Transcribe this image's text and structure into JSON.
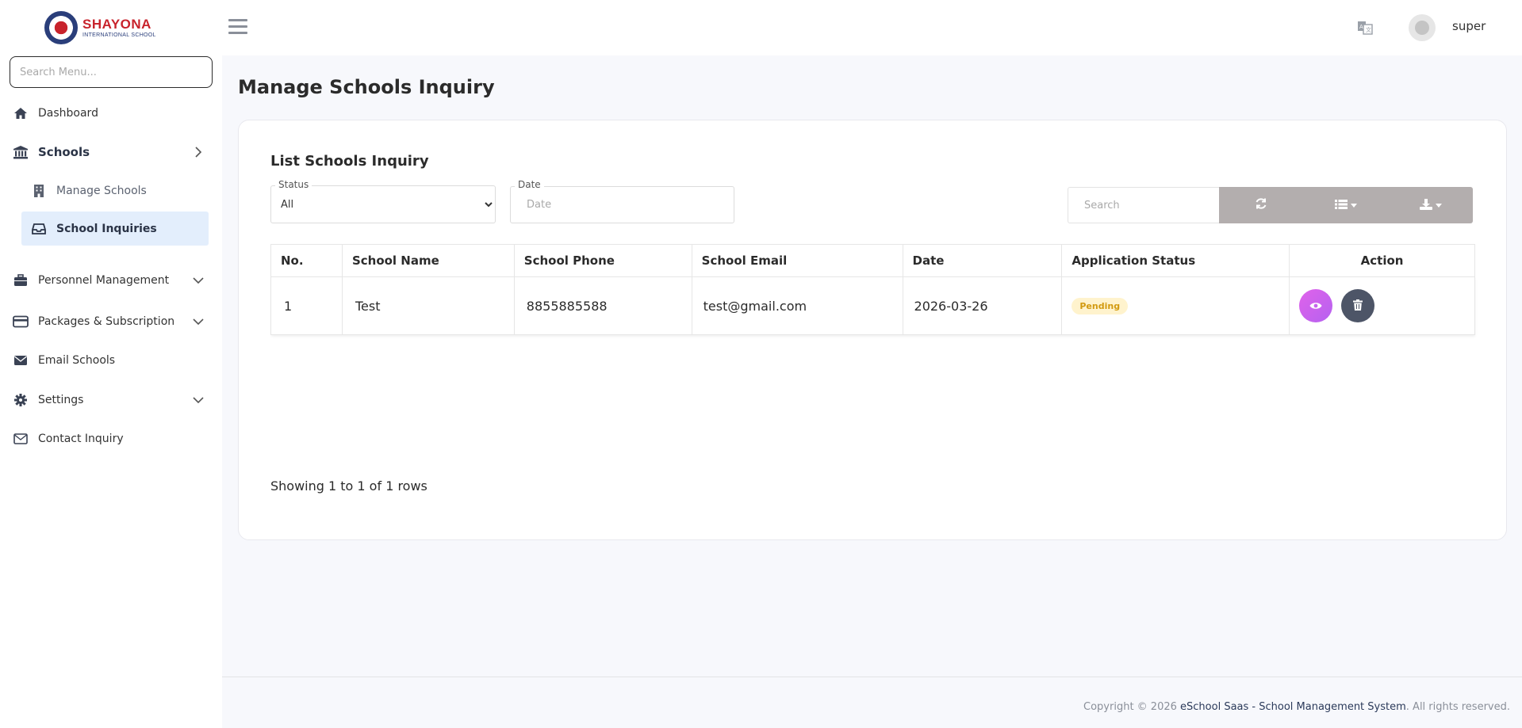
{
  "brand": {
    "name": "SHAYONA",
    "subtitle": "INTERNATIONAL SCHOOL"
  },
  "sidebar": {
    "search_placeholder": "Search Menu...",
    "items": [
      {
        "label": "Dashboard"
      },
      {
        "label": "Schools"
      },
      {
        "label": "Manage Schools"
      },
      {
        "label": "School Inquiries"
      },
      {
        "label": "Personnel Management"
      },
      {
        "label": "Packages & Subscription"
      },
      {
        "label": "Email Schools"
      },
      {
        "label": "Settings"
      },
      {
        "label": "Contact Inquiry"
      }
    ]
  },
  "header": {
    "username": "super"
  },
  "page": {
    "title": "Manage Schools Inquiry",
    "card_title": "List Schools Inquiry",
    "filters": {
      "status_label": "Status",
      "status_value": "All",
      "date_label": "Date",
      "date_placeholder": "Date",
      "search_placeholder": "Search"
    },
    "table": {
      "columns": [
        "No.",
        "School Name",
        "School Phone",
        "School Email",
        "Date",
        "Application Status",
        "Action"
      ],
      "rows": [
        {
          "no": "1",
          "name": "Test",
          "phone": "8855885588",
          "email": "test@gmail.com",
          "date": "2026-03-26",
          "status": "Pending"
        }
      ]
    },
    "showing": "Showing 1 to 1 of 1 rows"
  },
  "footer": {
    "prefix": "Copyright © 2026 ",
    "link": "eSchool Saas - School Management System",
    "suffix": ". All rights reserved."
  },
  "colors": {
    "accent": "#e3eefc",
    "pending_bg": "#fff3cd",
    "pending_text": "#d29a10",
    "view_btn": "#c862ee",
    "delete_btn": "#4d5567",
    "toolbar": "#b3aeae"
  }
}
